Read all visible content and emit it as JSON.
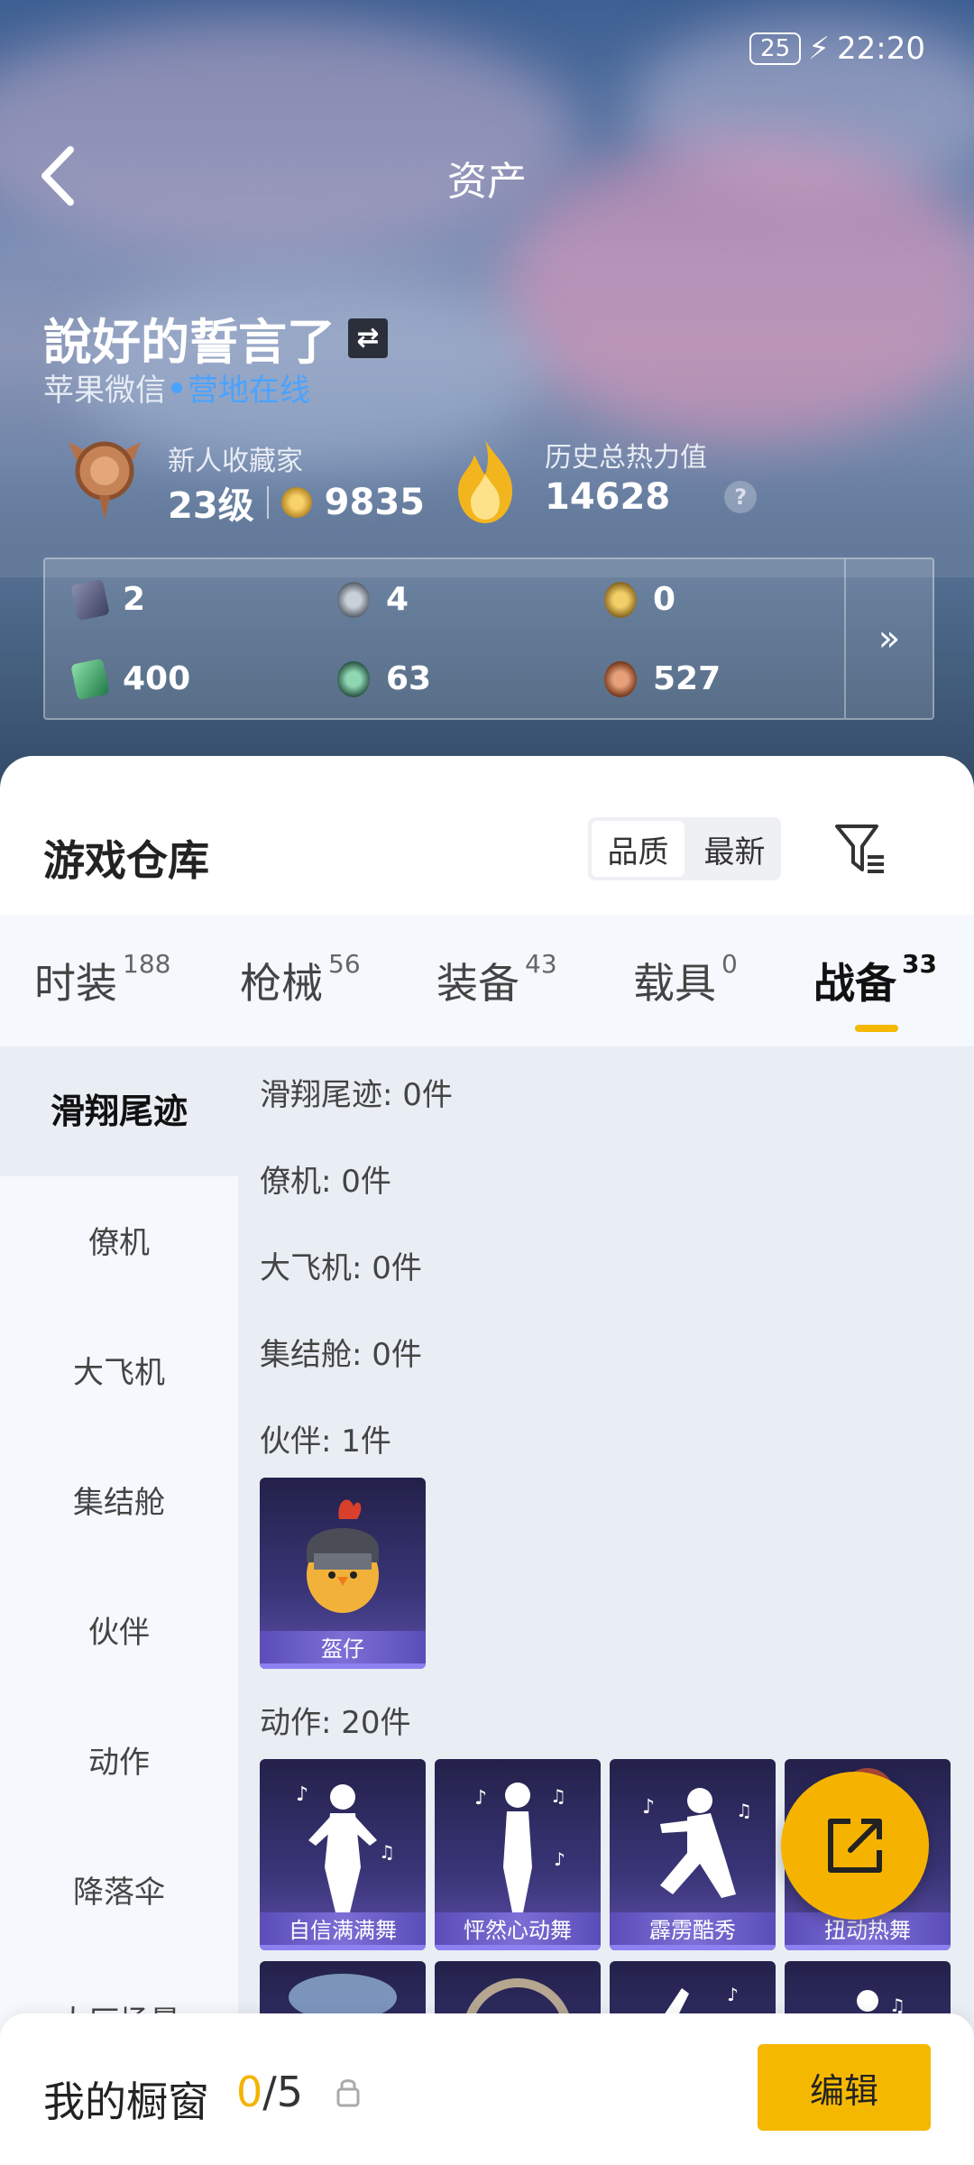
{
  "status": {
    "battery": "25",
    "time": "22:20"
  },
  "header": {
    "title": "资产"
  },
  "profile": {
    "name": "說好的誓言了",
    "platform": "苹果微信",
    "online": "营地在线",
    "level_title": "新人收藏家",
    "level": "23级",
    "coins": "9835",
    "heat_label": "历史总热力值",
    "heat_value": "14628"
  },
  "currencies": [
    {
      "icon": "card-icon",
      "value": "2"
    },
    {
      "icon": "silver-coin-icon",
      "value": "4"
    },
    {
      "icon": "gold-coin-icon",
      "value": "0"
    },
    {
      "icon": "ticket-icon",
      "value": "400"
    },
    {
      "icon": "green-coin-icon",
      "value": "63"
    },
    {
      "icon": "bronze-coin-icon",
      "value": "527"
    }
  ],
  "warehouse": {
    "title": "游戏仓库",
    "sort_options": [
      "品质",
      "最新"
    ],
    "selected_sort": "品质"
  },
  "tabs": [
    {
      "label": "时装",
      "count": "188"
    },
    {
      "label": "枪械",
      "count": "56"
    },
    {
      "label": "装备",
      "count": "43"
    },
    {
      "label": "载具",
      "count": "0"
    },
    {
      "label": "战备",
      "count": "33"
    }
  ],
  "active_tab": "战备",
  "sidebar": [
    "滑翔尾迹",
    "僚机",
    "大飞机",
    "集结舱",
    "伙伴",
    "动作",
    "降落伞",
    "大厅场景"
  ],
  "sections": [
    {
      "label": "滑翔尾迹: 0件"
    },
    {
      "label": "僚机: 0件"
    },
    {
      "label": "大飞机: 0件"
    },
    {
      "label": "集结舱: 0件"
    },
    {
      "label": "伙伴: 1件"
    },
    {
      "label": "动作: 20件"
    }
  ],
  "items": {
    "companion": [
      "盔仔"
    ],
    "actions": [
      "自信满满舞",
      "怦然心动舞",
      "霹雳酷秀",
      "扭动热舞"
    ]
  },
  "showcase": {
    "title": "我的橱窗",
    "count": "0",
    "total": "/5",
    "edit_label": "编辑"
  },
  "colors": {
    "accent": "#f5b800",
    "link": "#4aa3ff",
    "card": "#3a3578"
  }
}
